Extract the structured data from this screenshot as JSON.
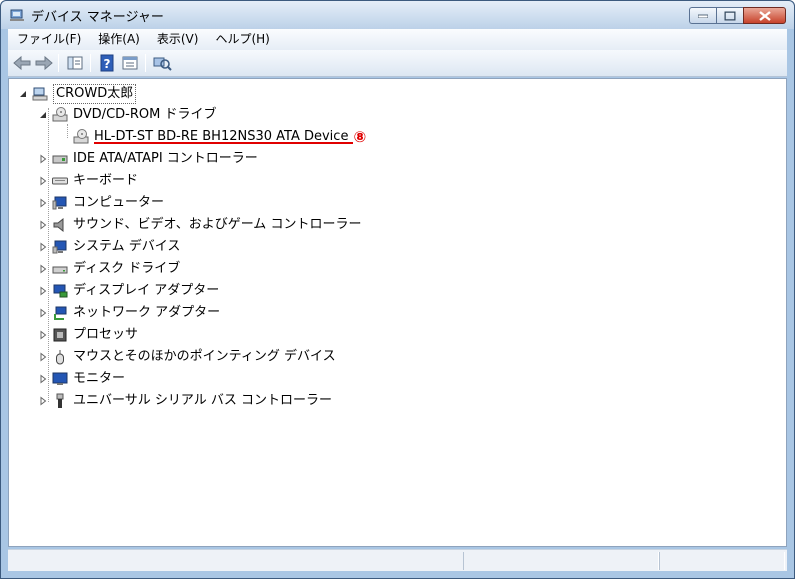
{
  "window": {
    "title": "デバイス マネージャー"
  },
  "menu": [
    "ファイル(F)",
    "操作(A)",
    "表示(V)",
    "ヘルプ(H)"
  ],
  "tree": {
    "root": "CROWD太郎",
    "dvd_category": "DVD/CD-ROM ドライブ",
    "dvd_device": "HL-DT-ST BD-RE  BH12NS30 ATA Device",
    "marker": "⑧",
    "categories": [
      "IDE ATA/ATAPI コントローラー",
      "キーボード",
      "コンピューター",
      "サウンド、ビデオ、およびゲーム コントローラー",
      "システム デバイス",
      "ディスク ドライブ",
      "ディスプレイ アダプター",
      "ネットワーク アダプター",
      "プロセッサ",
      "マウスとそのほかのポインティング デバイス",
      "モニター",
      "ユニバーサル シリアル バス コントローラー"
    ]
  },
  "colors": {
    "accent_red": "#e00000",
    "window_frame": "#a9c6e4"
  }
}
